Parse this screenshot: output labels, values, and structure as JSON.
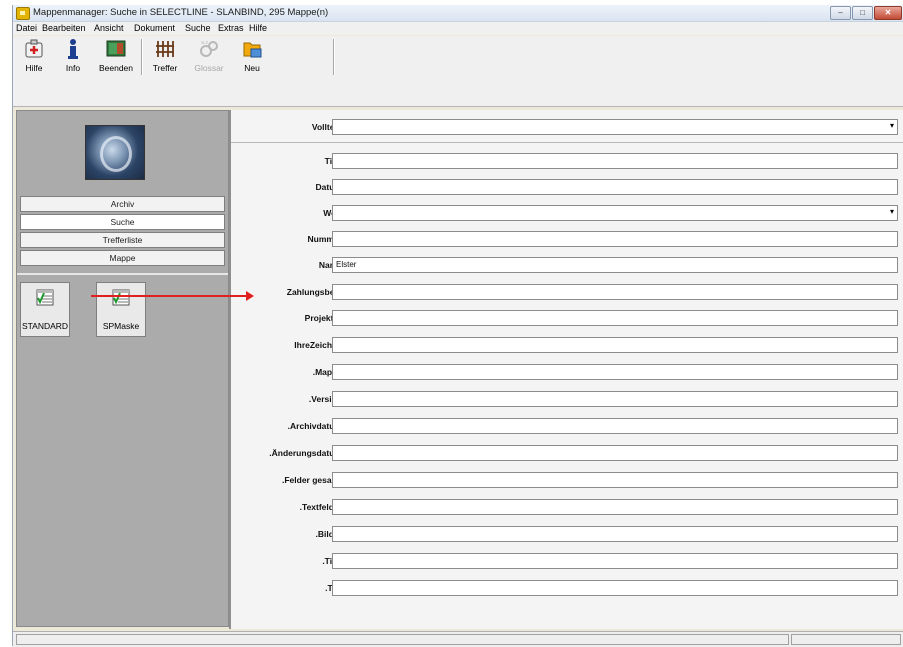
{
  "window": {
    "title": "Mappenmanager: Suche in SELECTLINE - SLANBIND, 295 Mappe(n)",
    "controls": {
      "minimize": "–",
      "maximize": "□",
      "close": "✕"
    }
  },
  "menu": [
    "Datei",
    "Bearbeiten",
    "Ansicht",
    "Dokument",
    "Suche",
    "Extras",
    "Hilfe"
  ],
  "toolbar": {
    "items": [
      {
        "label": "Hilfe",
        "icon": "help-icon",
        "enabled": true
      },
      {
        "label": "Info",
        "icon": "info-icon",
        "enabled": true
      },
      {
        "label": "Beenden",
        "icon": "exit-icon",
        "enabled": true
      },
      {
        "label": "Treffer",
        "icon": "hits-icon",
        "enabled": true
      },
      {
        "label": "Glossar",
        "icon": "glossary-icon",
        "enabled": false
      },
      {
        "label": "Neu",
        "icon": "new-folder-icon",
        "enabled": true
      }
    ]
  },
  "nav": {
    "items": [
      "Archiv",
      "Suche",
      "Trefferliste",
      "Mappe"
    ],
    "active": "Suche"
  },
  "masks": [
    "STANDARD",
    "SPMaske"
  ],
  "form": {
    "fields": [
      {
        "label": "Volltext",
        "value": "",
        "dropdown": true
      },
      {
        "label": "Titel",
        "value": ""
      },
      {
        "label": "Datum",
        "value": ""
      },
      {
        "label": "Wert",
        "value": "",
        "dropdown": true
      },
      {
        "label": "Nummer",
        "value": ""
      },
      {
        "label": "Name",
        "value": "Elster"
      },
      {
        "label": "Zahlungsbed.",
        "value": ""
      },
      {
        "label": "Projektnr",
        "value": ""
      },
      {
        "label": "IhreZeichen",
        "value": ""
      },
      {
        "label": ".Mappe",
        "value": ""
      },
      {
        "label": ".Version",
        "value": ""
      },
      {
        "label": ".Archivdatum",
        "value": ""
      },
      {
        "label": ".Änderungsdatum",
        "value": ""
      },
      {
        "label": ".Felder gesamt",
        "value": ""
      },
      {
        "label": ".Textfelder",
        "value": ""
      },
      {
        "label": ".Bilder",
        "value": ""
      },
      {
        "label": ".Titel",
        "value": ""
      },
      {
        "label": ".Typ",
        "value": ""
      }
    ]
  },
  "colors": {
    "arrow": "#e02020",
    "left_panel": "#ababab",
    "form_bg": "#f4f4f4"
  }
}
